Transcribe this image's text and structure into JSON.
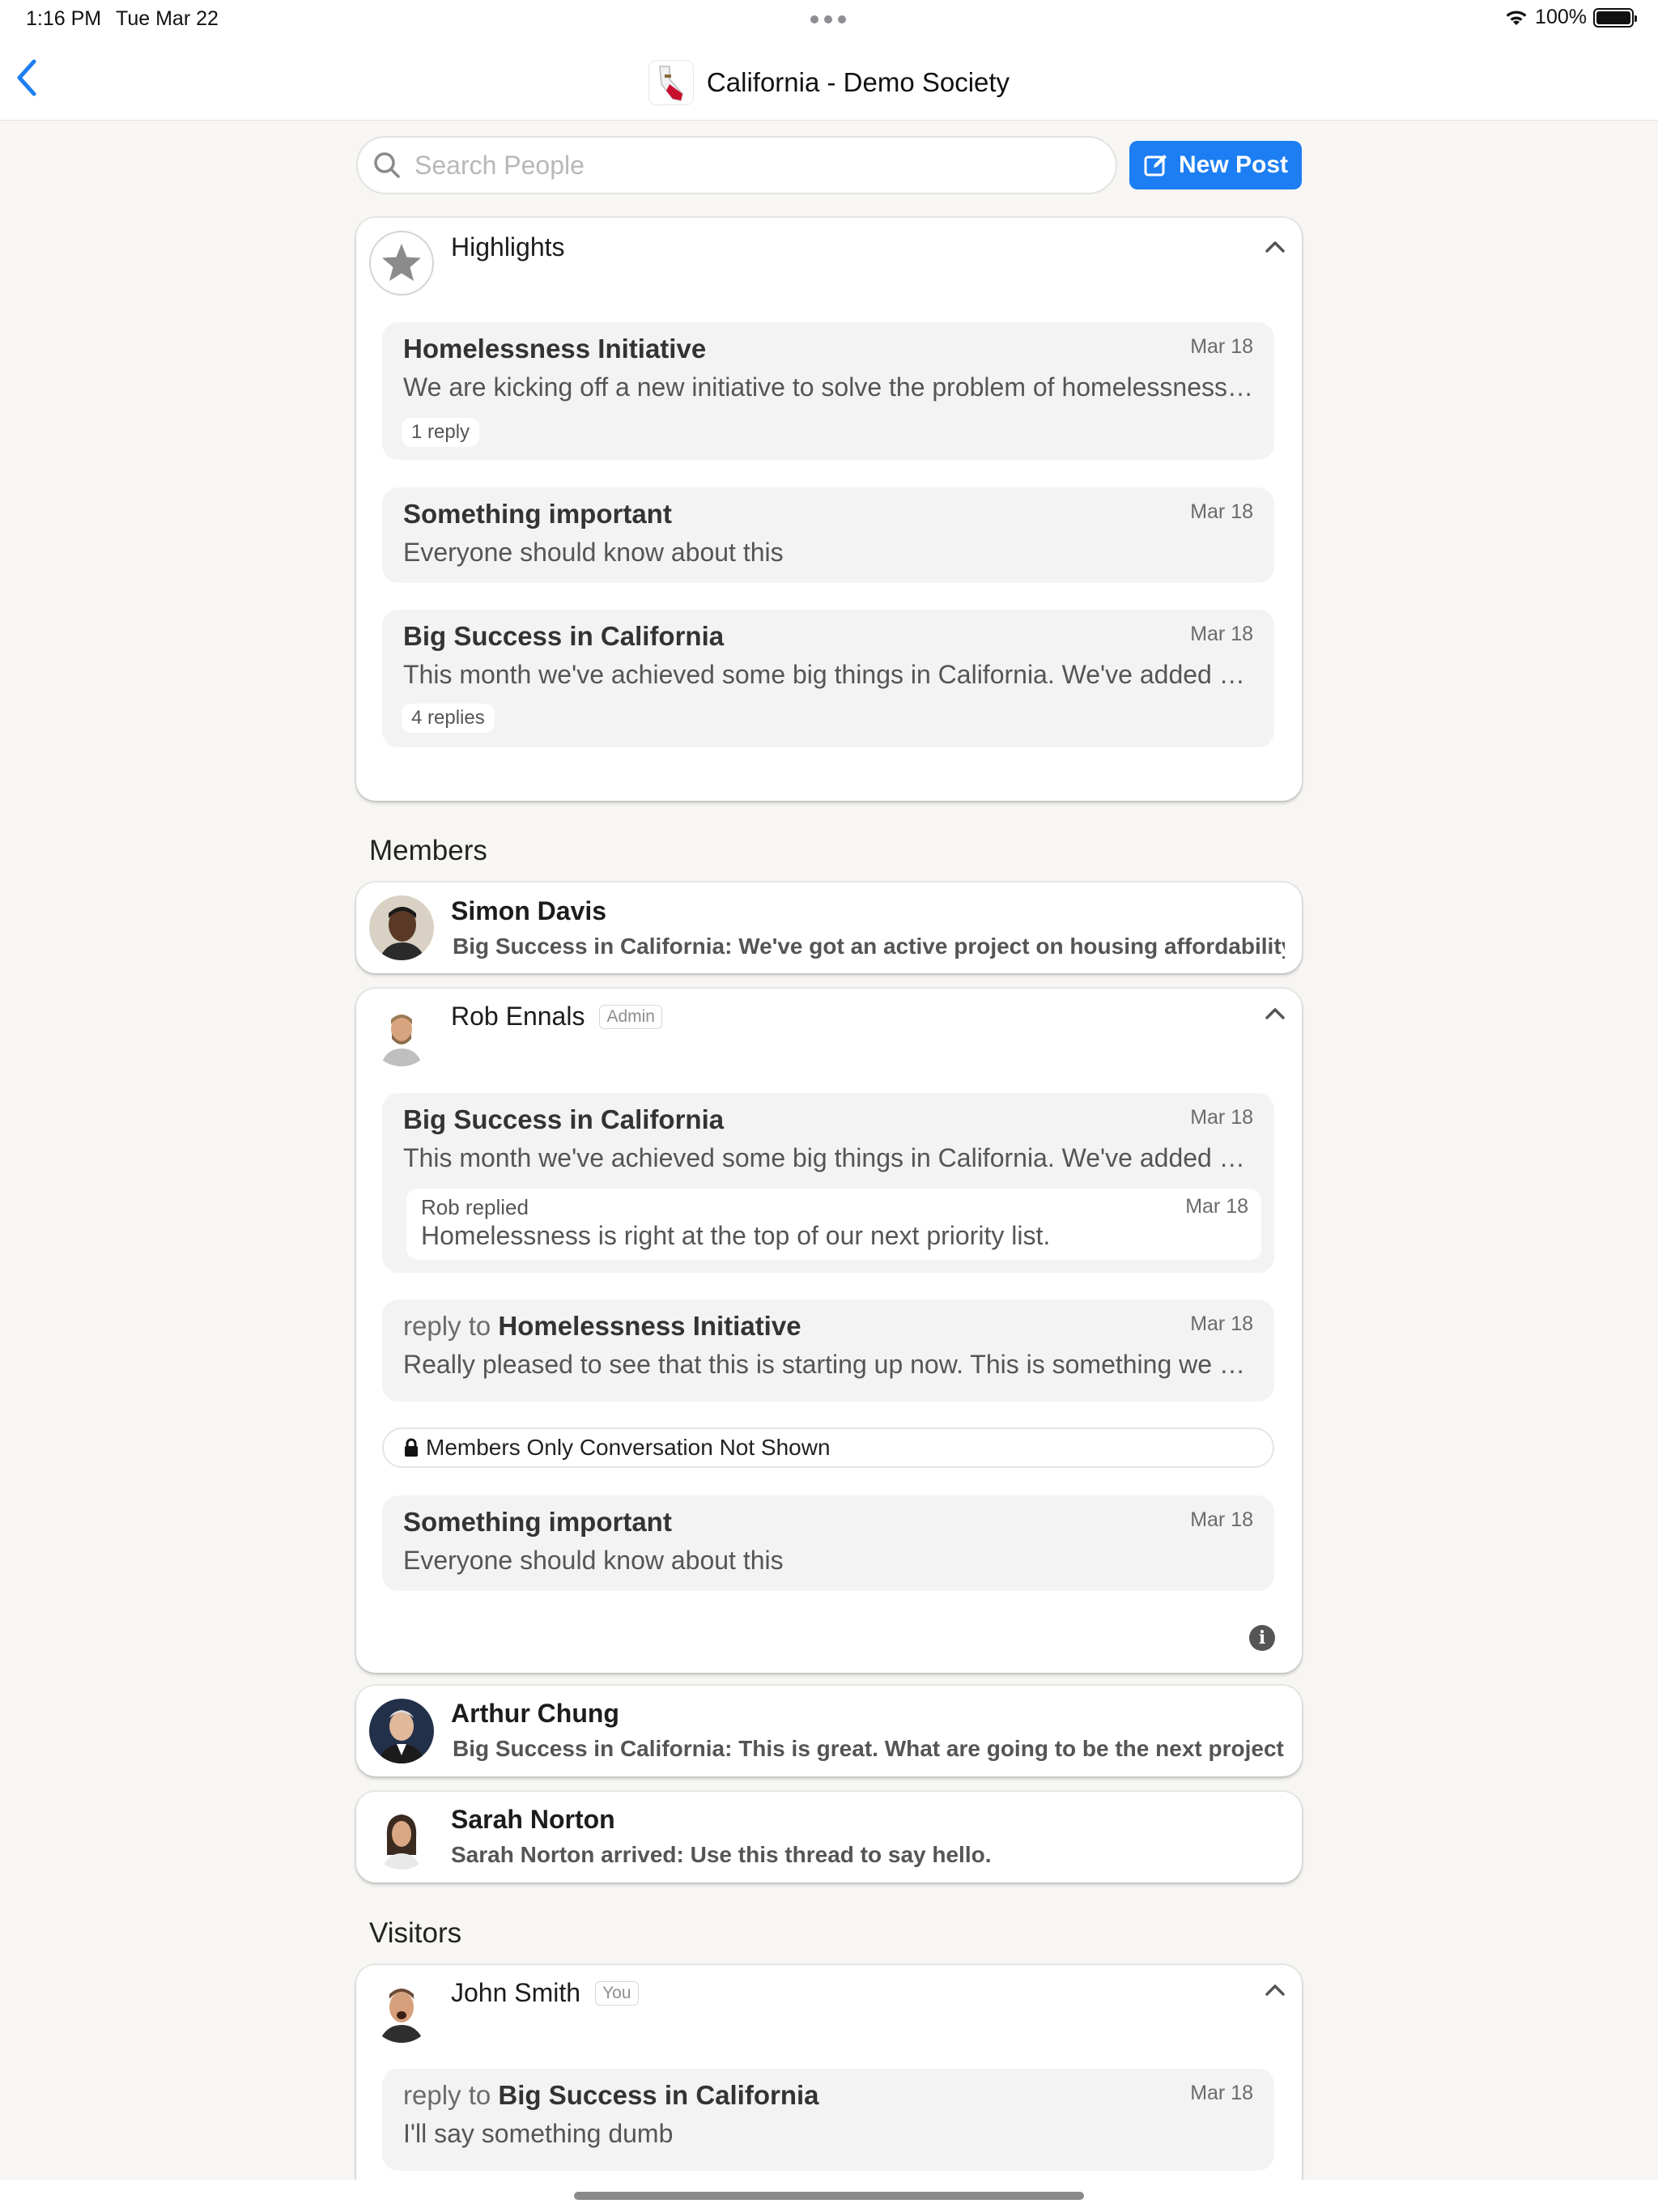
{
  "status_bar": {
    "time": "1:16 PM",
    "date": "Tue Mar 22",
    "battery": "100%"
  },
  "nav": {
    "title": "California - Demo Society"
  },
  "search": {
    "placeholder": "Search People"
  },
  "new_post": {
    "label": "New Post"
  },
  "highlights": {
    "title": "Highlights",
    "posts": [
      {
        "title": "Homelessness Initiative",
        "date": "Mar 18",
        "body": "We are kicking off a new initiative to solve the problem of homelessness in California and across the country",
        "replies": "1 reply"
      },
      {
        "title": "Something important",
        "date": "Mar 18",
        "body": "Everyone should know about this"
      },
      {
        "title": "Big Success in California",
        "date": "Mar 18",
        "body": "This month we've achieved some big things in California.  We've added many new members and volunteers",
        "replies": "4 replies"
      }
    ]
  },
  "members": {
    "heading": "Members",
    "simon": {
      "name": "Simon Davis",
      "preview": "Big Success in California: We've got an active project on housing affordability in our region"
    },
    "rob": {
      "name": "Rob Ennals",
      "badge": "Admin",
      "posts": [
        {
          "title": "Big Success in California",
          "date": "Mar 18",
          "body": "This month we've achieved some big things in California.  We've added many new members and volunteers",
          "reply": {
            "who": "Rob replied",
            "date": "Mar 18",
            "text": "Homelessness is right at the top of our next priority list."
          }
        },
        {
          "prefix": "reply to",
          "title": "Homelessness Initiative",
          "date": "Mar 18",
          "body": "Really pleased to see that this is starting up now. This is something we have been waiting for"
        },
        {
          "title": "Something important",
          "date": "Mar 18",
          "body": "Everyone should know about this"
        }
      ],
      "members_only": "Members Only Conversation Not Shown"
    },
    "arthur": {
      "name": "Arthur Chung",
      "preview": "Big Success in California: This is great. What are going to be the next projects we take on?"
    },
    "sarah": {
      "name": "Sarah Norton",
      "preview": "Sarah Norton arrived: Use this thread to say hello."
    }
  },
  "visitors": {
    "heading": "Visitors",
    "john": {
      "name": "John Smith",
      "badge": "You",
      "posts": [
        {
          "prefix": "reply to",
          "title": "Big Success in California",
          "date": "Mar 18",
          "body": "I'll say something dumb"
        }
      ]
    }
  },
  "colors": {
    "accent": "#1c7ef2",
    "background": "#f8f6f3",
    "post_bg": "#f3f3f3"
  }
}
